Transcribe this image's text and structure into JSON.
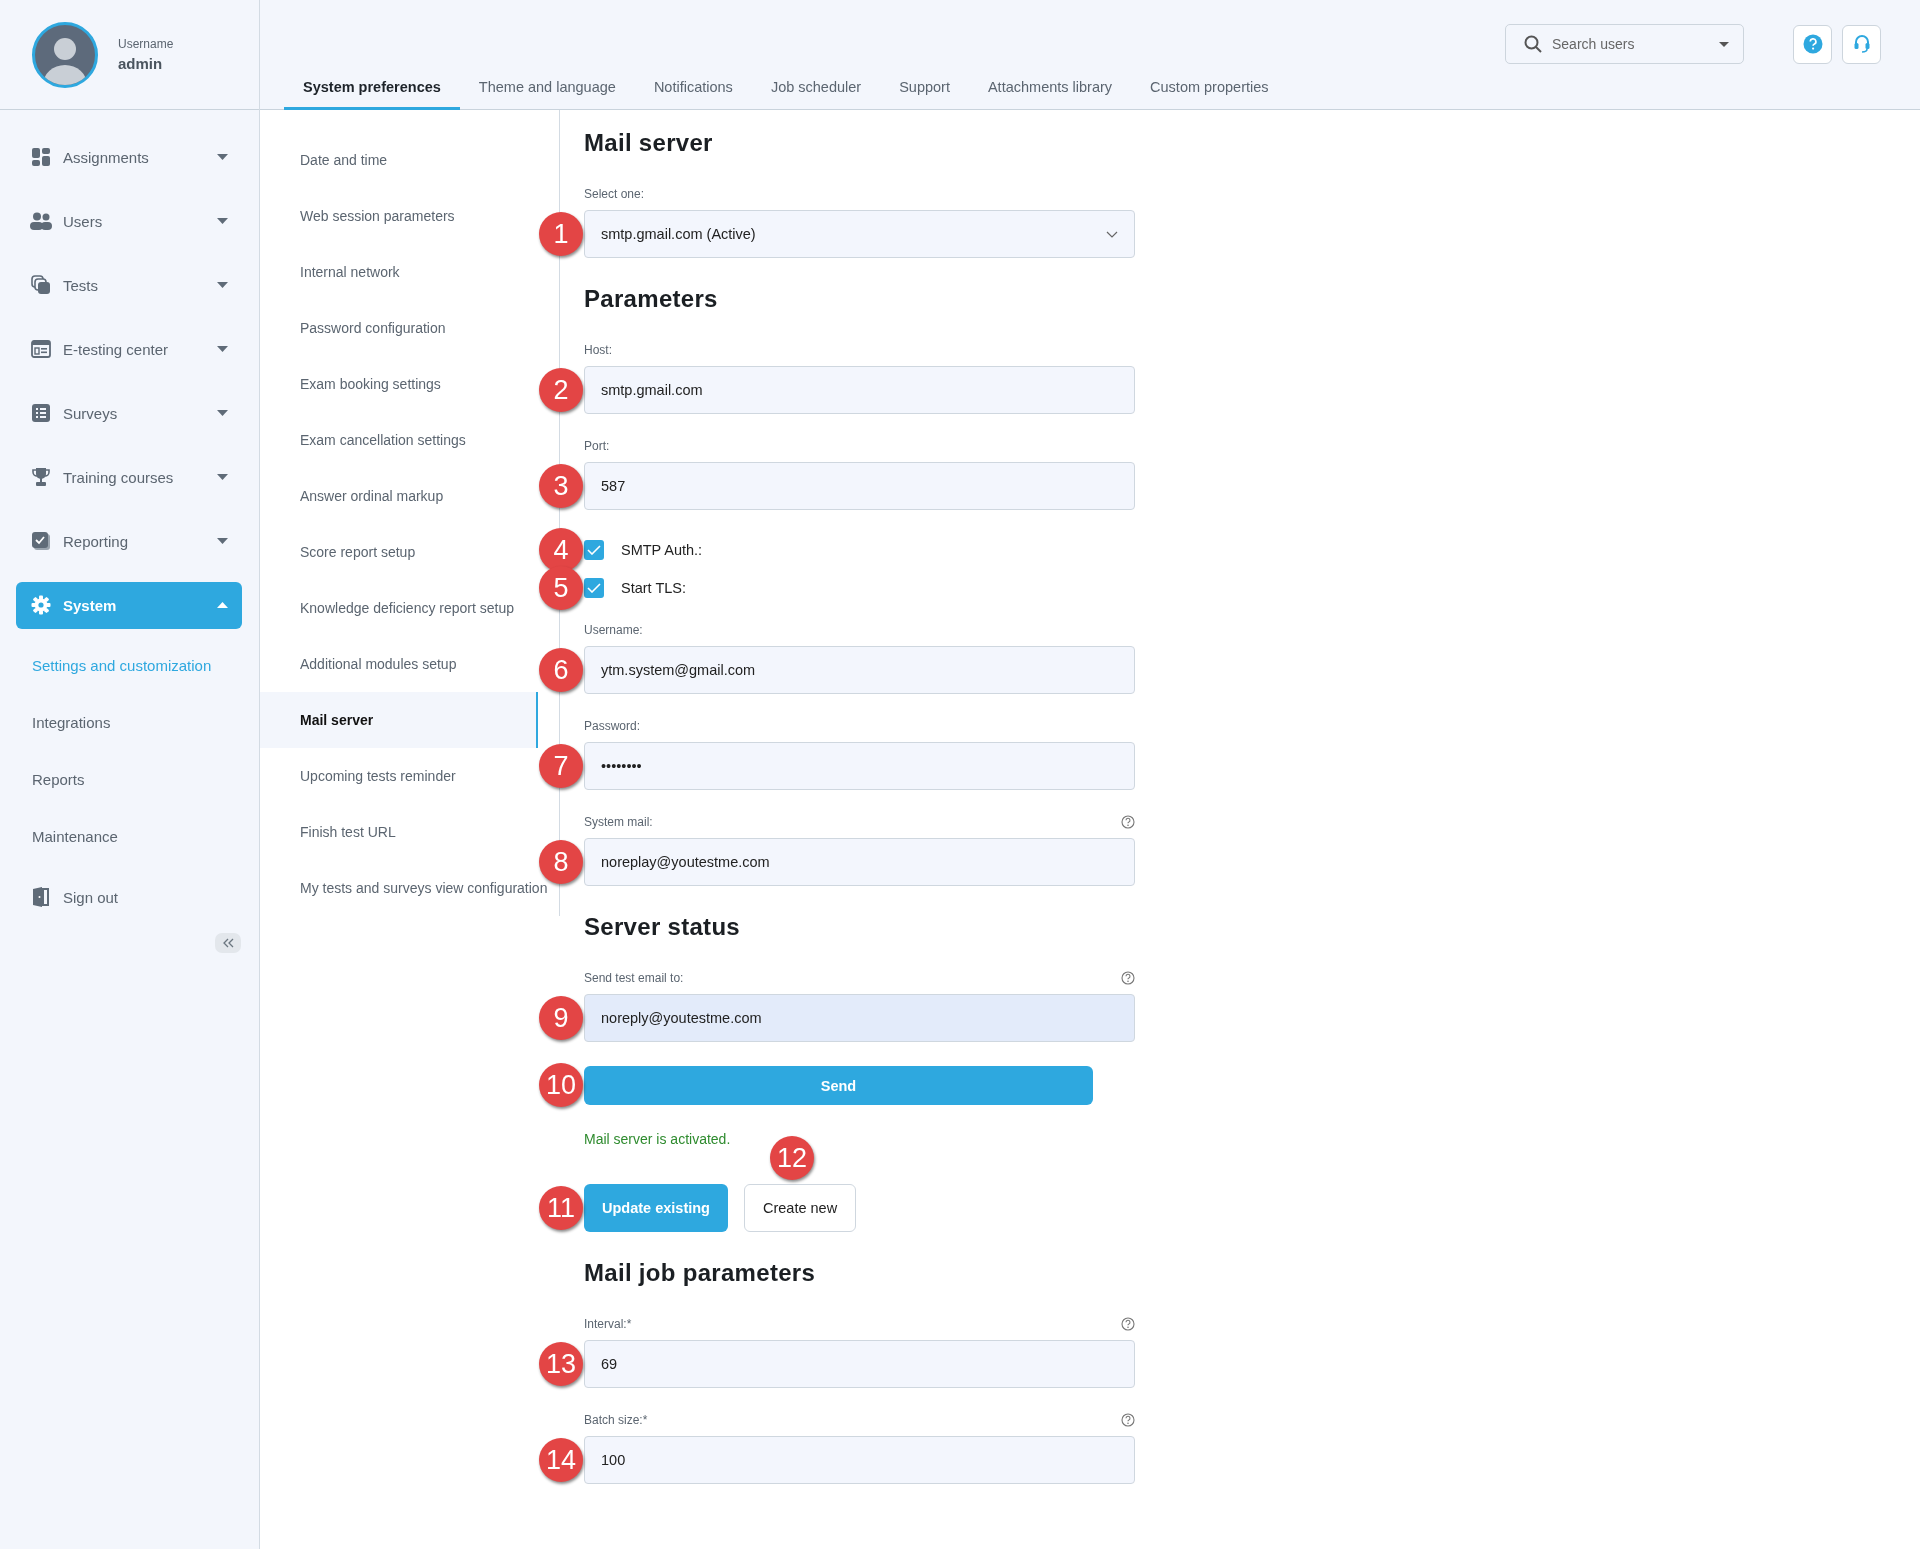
{
  "user": {
    "label": "Username",
    "name": "admin"
  },
  "nav": [
    {
      "label": "Assignments",
      "expanded": false,
      "selected": false
    },
    {
      "label": "Users",
      "expanded": false,
      "selected": false
    },
    {
      "label": "Tests",
      "expanded": false,
      "selected": false
    },
    {
      "label": "E-testing center",
      "expanded": false,
      "selected": false
    },
    {
      "label": "Surveys",
      "expanded": false,
      "selected": false
    },
    {
      "label": "Training courses",
      "expanded": false,
      "selected": false
    },
    {
      "label": "Reporting",
      "expanded": false,
      "selected": false
    },
    {
      "label": "System",
      "expanded": true,
      "selected": true,
      "children": [
        {
          "label": "Settings and customization",
          "selected": true
        },
        {
          "label": "Integrations",
          "selected": false
        },
        {
          "label": "Reports",
          "selected": false
        },
        {
          "label": "Maintenance",
          "selected": false
        }
      ]
    }
  ],
  "sign_out": {
    "label": "Sign out"
  },
  "search": {
    "placeholder": "Search users"
  },
  "tabs": [
    {
      "label": "System preferences",
      "selected": true
    },
    {
      "label": "Theme and language",
      "selected": false
    },
    {
      "label": "Notifications",
      "selected": false
    },
    {
      "label": "Job scheduler",
      "selected": false
    },
    {
      "label": "Support",
      "selected": false
    },
    {
      "label": "Attachments library",
      "selected": false
    },
    {
      "label": "Custom properties",
      "selected": false
    }
  ],
  "settings_menu": [
    {
      "label": "Date and time",
      "selected": false
    },
    {
      "label": "Web session parameters",
      "selected": false
    },
    {
      "label": "Internal network",
      "selected": false
    },
    {
      "label": "Password configuration",
      "selected": false
    },
    {
      "label": "Exam booking settings",
      "selected": false
    },
    {
      "label": "Exam cancellation settings",
      "selected": false
    },
    {
      "label": "Answer ordinal markup",
      "selected": false
    },
    {
      "label": "Score report setup",
      "selected": false
    },
    {
      "label": "Knowledge deficiency report setup",
      "selected": false
    },
    {
      "label": "Additional modules setup",
      "selected": false
    },
    {
      "label": "Mail server",
      "selected": true
    },
    {
      "label": "Upcoming tests reminder",
      "selected": false
    },
    {
      "label": "Finish test URL",
      "selected": false
    },
    {
      "label": "My tests and surveys view configuration",
      "selected": false
    }
  ],
  "sections": [
    {
      "title": "Mail server",
      "fields": [
        {
          "kind": "select",
          "label": "Select one:",
          "value": "smtp.gmail.com (Active)",
          "marker": "1"
        }
      ]
    },
    {
      "title": "Parameters",
      "fields": [
        {
          "kind": "text",
          "label": "Host:",
          "value": "smtp.gmail.com",
          "marker": "2"
        },
        {
          "kind": "text",
          "label": "Port:",
          "value": "587",
          "marker": "3"
        },
        {
          "kind": "checkbox",
          "label": "SMTP Auth.:",
          "checked": true,
          "marker": "4"
        },
        {
          "kind": "checkbox",
          "label": "Start TLS:",
          "checked": true,
          "marker": "5"
        },
        {
          "kind": "text",
          "label": "Username:",
          "value": "ytm.system@gmail.com",
          "marker": "6"
        },
        {
          "kind": "text",
          "label": "Password:",
          "value": "••••••••",
          "marker": "7"
        },
        {
          "kind": "text",
          "label": "System mail:",
          "value": "noreplay@youtestme.com",
          "help": true,
          "marker": "8"
        }
      ]
    },
    {
      "title": "Server status",
      "fields": [
        {
          "kind": "text",
          "label": "Send test email to:",
          "value": "noreply@youtestme.com",
          "help": true,
          "autofilled": true,
          "marker": "9"
        },
        {
          "kind": "button",
          "label": "Send",
          "primary": true,
          "marker": "10"
        },
        {
          "kind": "message",
          "text": "Mail server is activated."
        },
        {
          "kind": "buttons",
          "buttons": [
            {
              "label": "Update existing",
              "primary": true,
              "marker": "11"
            },
            {
              "label": "Create new",
              "primary": false,
              "marker": "12"
            }
          ]
        }
      ]
    },
    {
      "title": "Mail job parameters",
      "fields": [
        {
          "kind": "text",
          "label": "Interval:*",
          "value": "69",
          "help": true,
          "marker": "13"
        },
        {
          "kind": "text",
          "label": "Batch size:*",
          "value": "100",
          "help": true,
          "marker": "14"
        }
      ]
    }
  ]
}
